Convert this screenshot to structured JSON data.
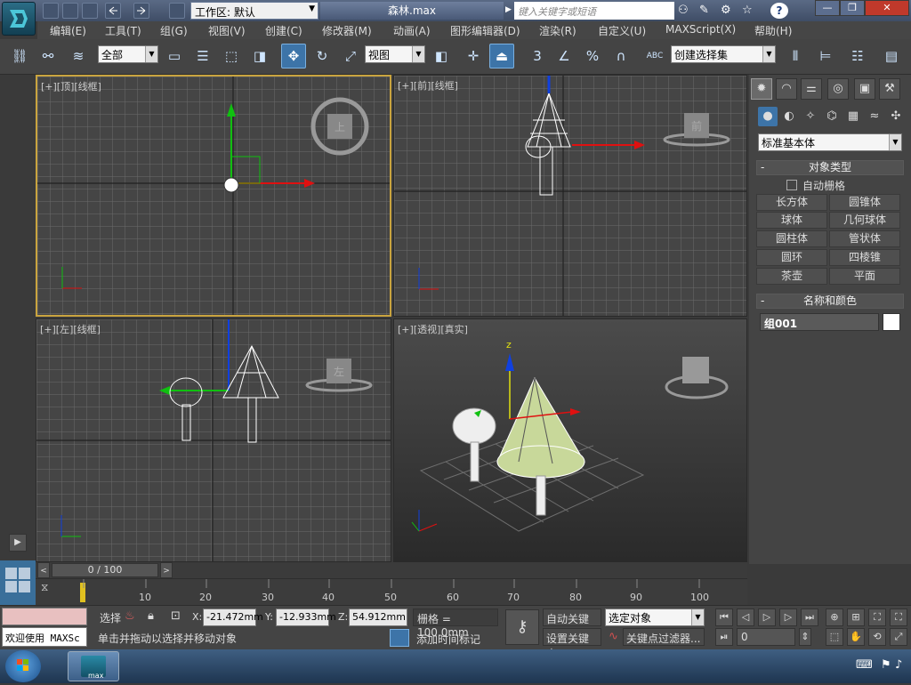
{
  "titlebar": {
    "workspace_label": "工作区: 默认",
    "document_name": "森林.max",
    "search_placeholder": "键入关键字或短语",
    "help_label": "?"
  },
  "menubar": {
    "items": [
      "编辑(E)",
      "工具(T)",
      "组(G)",
      "视图(V)",
      "创建(C)",
      "修改器(M)",
      "动画(A)",
      "图形编辑器(D)",
      "渲染(R)",
      "自定义(U)",
      "MAXScript(X)",
      "帮助(H)"
    ]
  },
  "toolbar": {
    "selection_filter": "全部",
    "reference_coord": "视图",
    "named_selection": "创建选择集",
    "snap_angle_label": "3",
    "percent_snap_label": "%",
    "spinner_snap_label": "ABC"
  },
  "viewports": {
    "top": {
      "label": "[+][顶][线框]",
      "cube_text": "上"
    },
    "front": {
      "label": "[+][前][线框]",
      "cube_text": "前"
    },
    "left": {
      "label": "[+][左][线框]",
      "cube_text": "左"
    },
    "perspective": {
      "label": "[+][透视][真实]",
      "axis_z": "z"
    }
  },
  "command_panel": {
    "category": "标准基本体",
    "object_type_header": "对象类型",
    "autogrid_label": "自动栅格",
    "object_buttons": [
      "长方体",
      "圆锥体",
      "球体",
      "几何球体",
      "圆柱体",
      "管状体",
      "圆环",
      "四棱锥",
      "茶壶",
      "平面"
    ],
    "name_color_header": "名称和颜色",
    "object_name": "组001",
    "object_color": "#ffffff",
    "rollout_minus": "-"
  },
  "timeline": {
    "frame_display": "0 / 100",
    "ticks": [
      "10",
      "20",
      "30",
      "40",
      "50",
      "60",
      "70",
      "80",
      "90",
      "100"
    ]
  },
  "statusbar": {
    "welcome_text": "欢迎使用 MAXSc",
    "selected_label": "选择",
    "x_label": "X:",
    "x_value": "-21.472mm",
    "y_label": "Y:",
    "y_value": "-12.933mm",
    "z_label": "Z:",
    "z_value": "54.912mm",
    "grid_text": "栅格 = 100.0mm",
    "prompt_text": "单击并拖动以选择并移动对象",
    "add_time_tag": "添加时间标记",
    "auto_key": "自动关键点",
    "set_key": "设置关键点",
    "selected_object": "选定对象",
    "key_filter": "关键点过滤器...",
    "current_frame": "0"
  },
  "colors": {
    "accent": "#3d74a8",
    "active_viewport_border": "#c9a43f",
    "axis_x": "#e01010",
    "axis_y": "#10c010",
    "axis_z": "#1040e0"
  },
  "taskbar": {
    "app_label": "max"
  }
}
